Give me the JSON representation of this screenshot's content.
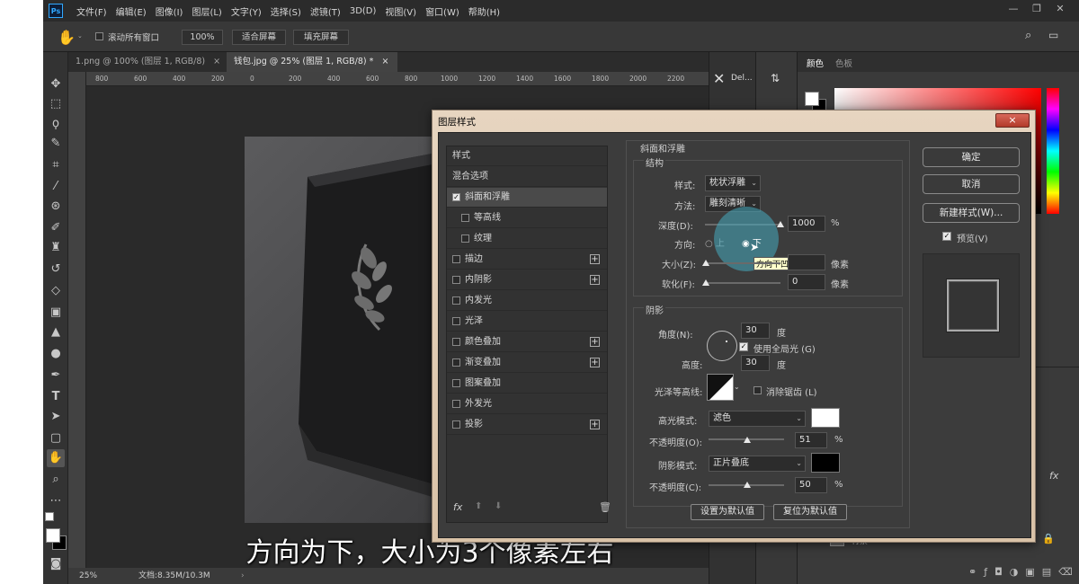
{
  "app": {
    "logo": "Ps"
  },
  "menu": [
    "文件(F)",
    "编辑(E)",
    "图像(I)",
    "图层(L)",
    "文字(Y)",
    "选择(S)",
    "滤镜(T)",
    "3D(D)",
    "视图(V)",
    "窗口(W)",
    "帮助(H)"
  ],
  "options": {
    "scroll_all": "滚动所有窗口",
    "zoom": "100%",
    "fit_screen": "适合屏幕",
    "fill_screen": "填充屏幕"
  },
  "tabs": [
    {
      "label": "1.png @ 100% (图层 1, RGB/8)",
      "close": "×"
    },
    {
      "label": "钱包.jpg @ 25% (图层 1, RGB/8) *",
      "close": "×"
    }
  ],
  "ruler_ticks": [
    "800",
    "600",
    "400",
    "200",
    "0",
    "200",
    "400",
    "600",
    "800",
    "1000",
    "1200",
    "1400",
    "1600",
    "1800",
    "2000",
    "2200"
  ],
  "status": {
    "zoom": "25%",
    "doc": "文档:8.35M/10.3M"
  },
  "caption": "方向为下，大小为3个像素左右",
  "panels": {
    "icon_label": "Del...",
    "color_tab": "颜色",
    "swatches_tab": "色板",
    "layer_background": "背景"
  },
  "dialog": {
    "title": "图层样式",
    "close": "×",
    "styles": [
      {
        "label": "样式",
        "check": false,
        "plus": false,
        "indent": false,
        "active": false,
        "header": true
      },
      {
        "label": "混合选项",
        "check": false,
        "plus": false,
        "indent": false,
        "active": false,
        "header": true
      },
      {
        "label": "斜面和浮雕",
        "check": true,
        "plus": false,
        "indent": false,
        "active": true
      },
      {
        "label": "等高线",
        "check": false,
        "plus": false,
        "indent": true,
        "active": false
      },
      {
        "label": "纹理",
        "check": false,
        "plus": false,
        "indent": true,
        "active": false
      },
      {
        "label": "描边",
        "check": false,
        "plus": true,
        "indent": false,
        "active": false
      },
      {
        "label": "内阴影",
        "check": false,
        "plus": true,
        "indent": false,
        "active": false
      },
      {
        "label": "内发光",
        "check": false,
        "plus": false,
        "indent": false,
        "active": false
      },
      {
        "label": "光泽",
        "check": false,
        "plus": false,
        "indent": false,
        "active": false
      },
      {
        "label": "颜色叠加",
        "check": false,
        "plus": true,
        "indent": false,
        "active": false
      },
      {
        "label": "渐变叠加",
        "check": false,
        "plus": true,
        "indent": false,
        "active": false
      },
      {
        "label": "图案叠加",
        "check": false,
        "plus": false,
        "indent": false,
        "active": false
      },
      {
        "label": "外发光",
        "check": false,
        "plus": false,
        "indent": false,
        "active": false
      },
      {
        "label": "投影",
        "check": false,
        "plus": true,
        "indent": false,
        "active": false
      }
    ],
    "section_title": "斜面和浮雕",
    "structure": {
      "title": "结构",
      "style_label": "样式:",
      "style_value": "枕状浮雕",
      "method_label": "方法:",
      "method_value": "雕刻清晰",
      "depth_label": "深度(D):",
      "depth_value": "1000",
      "depth_unit": "%",
      "direction_label": "方向:",
      "dir_up": "上",
      "dir_down": "下",
      "size_label": "大小(Z):",
      "size_unit": "像素",
      "soften_label": "软化(F):",
      "soften_value": "0",
      "soften_unit": "像素",
      "tooltip": "方向下凹"
    },
    "shading": {
      "title": "阴影",
      "angle_label": "角度(N):",
      "angle_value": "30",
      "angle_unit": "度",
      "global_light": "使用全局光 (G)",
      "altitude_label": "高度:",
      "altitude_value": "30",
      "altitude_unit": "度",
      "gloss_label": "光泽等高线:",
      "antialias": "消除锯齿 (L)",
      "highlight_label": "高光模式:",
      "highlight_value": "滤色",
      "hl_opacity_label": "不透明度(O):",
      "hl_opacity_value": "51",
      "hl_opacity_unit": "%",
      "shadow_label": "阴影模式:",
      "shadow_value": "正片叠底",
      "sh_opacity_label": "不透明度(C):",
      "sh_opacity_value": "50",
      "sh_opacity_unit": "%"
    },
    "set_default": "设置为默认值",
    "reset_default": "复位为默认值",
    "ok": "确定",
    "cancel": "取消",
    "new_style": "新建样式(W)...",
    "preview": "预览(V)",
    "highlight_color": "#ffffff",
    "shadow_color": "#000000"
  }
}
